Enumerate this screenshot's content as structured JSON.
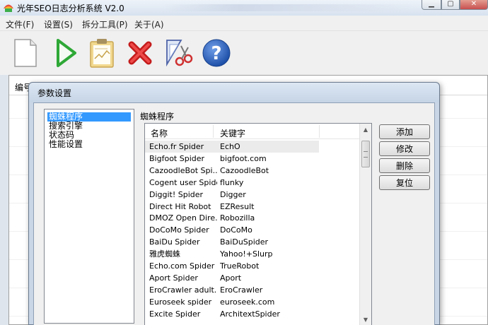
{
  "window": {
    "title": "光年SEO日志分析系统 V2.0"
  },
  "menu": [
    "文件(F)",
    "设置(S)",
    "拆分工具(P)",
    "关于(A)"
  ],
  "toolbar": [
    {
      "icon": "new-document-icon"
    },
    {
      "icon": "play-icon"
    },
    {
      "icon": "clipboard-icon"
    },
    {
      "icon": "delete-x-icon"
    },
    {
      "icon": "split-scissors-icon"
    },
    {
      "icon": "help-icon"
    }
  ],
  "main": {
    "column_header": "编号"
  },
  "dialog": {
    "title": "参数设置",
    "tree": [
      "蜘蛛程序",
      "搜索引擎",
      "状态码",
      "性能设置"
    ],
    "selected": 0,
    "section_label": "蜘蛛程序",
    "list": {
      "columns": [
        "名称",
        "关键字"
      ],
      "rows": [
        [
          "Echo.fr Spider",
          "EchO"
        ],
        [
          "Bigfoot Spider",
          "bigfoot.com"
        ],
        [
          "CazoodleBot Spi...",
          "CazoodleBot"
        ],
        [
          "Cogent user Spider",
          "flunky"
        ],
        [
          "Diggit! Spider",
          "Digger"
        ],
        [
          "Direct Hit Robot",
          "EZResult"
        ],
        [
          "DMOZ Open Dire...",
          "Robozilla"
        ],
        [
          "DoCoMo Spider",
          "DoCoMo"
        ],
        [
          "BaiDu Spider",
          "BaiDuSpider"
        ],
        [
          "雅虎蜘蛛",
          "Yahoo!+Slurp"
        ],
        [
          "Echo.com Spider",
          "TrueRobot"
        ],
        [
          "Aport Spider",
          "Aport"
        ],
        [
          "EroCrawler adult...",
          "EroCrawler"
        ],
        [
          "Euroseek spider",
          "euroseek.com"
        ],
        [
          "Excite Spider",
          "ArchitextSpider"
        ]
      ]
    },
    "buttons": [
      "添加",
      "修改",
      "删除",
      "复位"
    ]
  }
}
